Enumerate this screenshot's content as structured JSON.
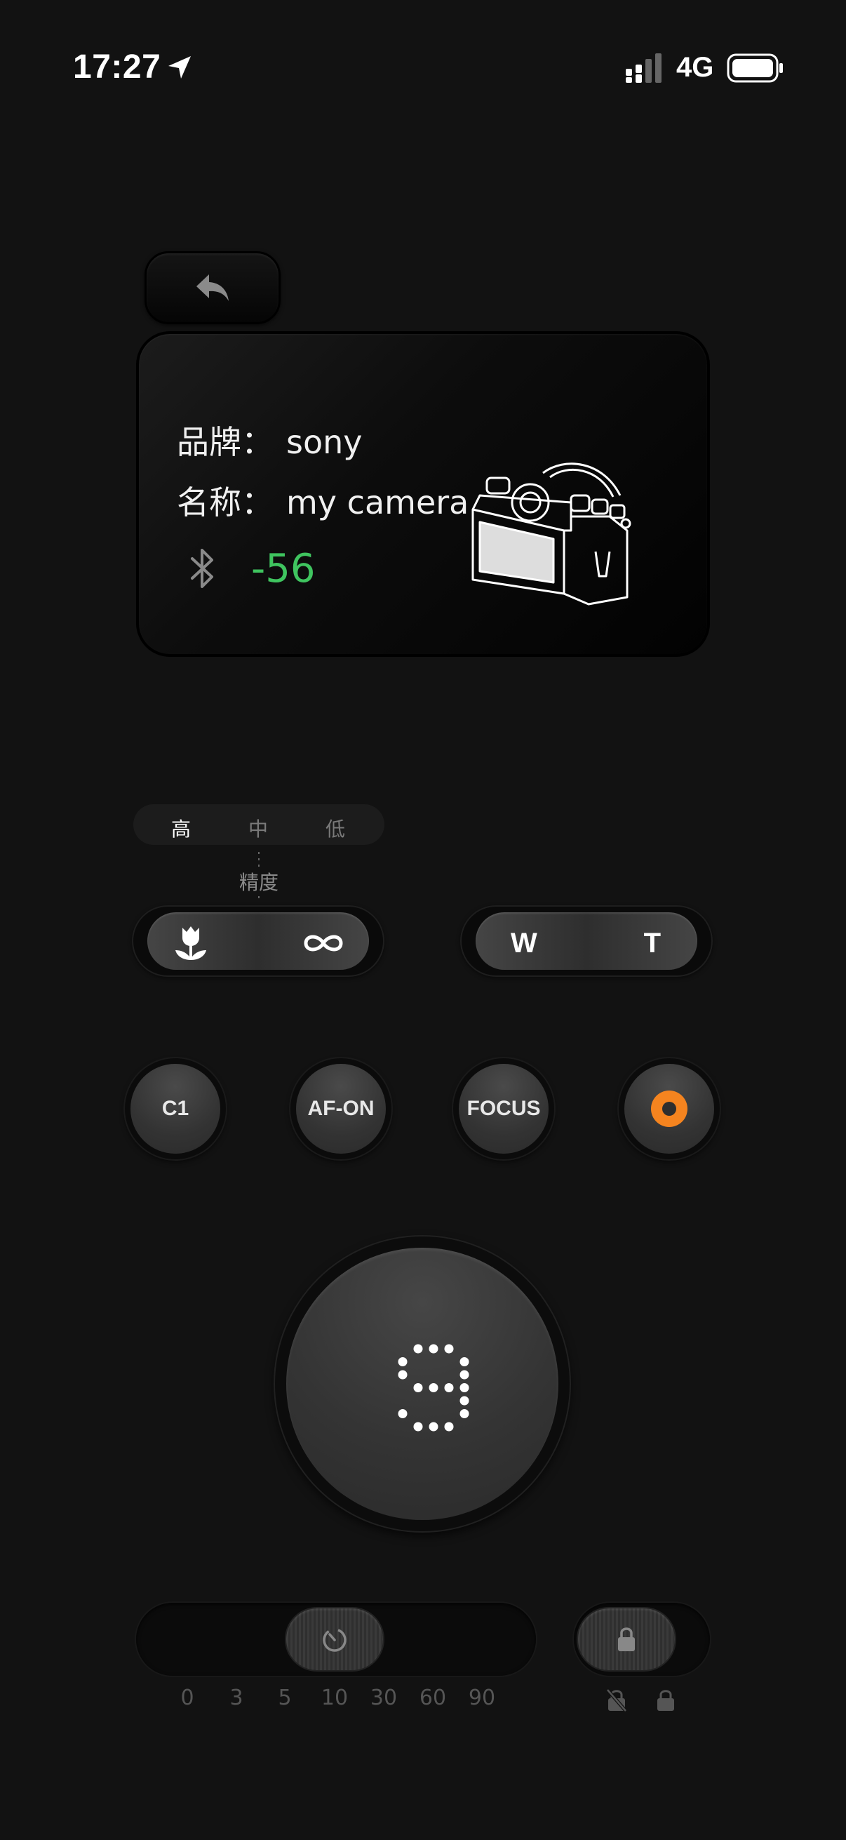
{
  "status_bar": {
    "time": "17:27",
    "network": "4G"
  },
  "device": {
    "brand_label": "品牌：",
    "brand_value": "sony",
    "name_label": "名称：",
    "name_value": "my camera",
    "rssi": "-56",
    "rssi_color": "#3fc45f"
  },
  "precision": {
    "options": [
      "高",
      "中",
      "低"
    ],
    "selected": "高",
    "label": "精度"
  },
  "focus_slider": {
    "left_icon": "macro-flower-icon",
    "right_icon": "infinity-icon"
  },
  "zoom_slider": {
    "left": "W",
    "right": "T"
  },
  "buttons": {
    "c1": "C1",
    "af_on": "AF-ON",
    "focus": "FOCUS",
    "record_icon": "record-icon",
    "record_color": "#f5841f"
  },
  "shutter": {
    "count": "9"
  },
  "timer": {
    "options": [
      "0",
      "3",
      "5",
      "10",
      "30",
      "60",
      "90"
    ],
    "selected": "10"
  },
  "lock": {
    "options": [
      "unlock-icon",
      "lock-icon"
    ],
    "selected": "unlock-icon"
  }
}
